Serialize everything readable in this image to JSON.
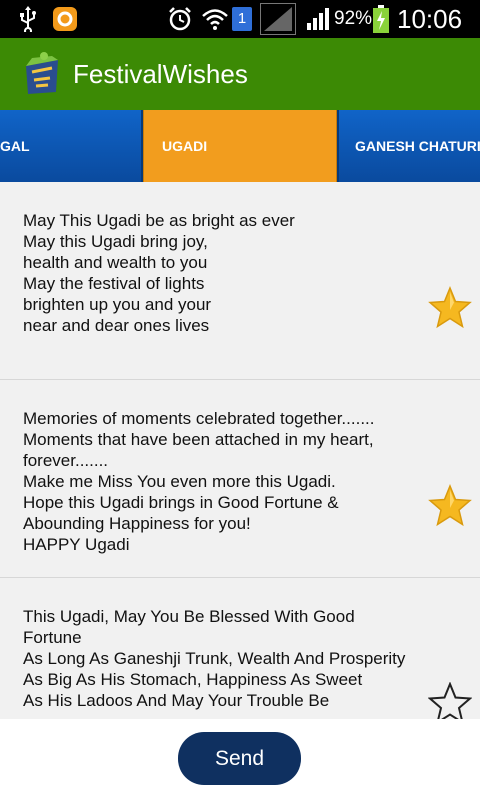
{
  "status_bar": {
    "icons": [
      "usb-icon",
      "notification-app-icon",
      "alarm-icon",
      "wifi-icon",
      "sim-slot-icon",
      "signal-empty-icon",
      "signal-icon",
      "battery-charging-icon"
    ],
    "sim_slot": "1",
    "battery_percent": "92%",
    "time": "10:06"
  },
  "app_bar": {
    "title": "FestivalWishes",
    "logo_icon": "festival-lantern-icon"
  },
  "tabs": [
    {
      "label": "GAL",
      "active": false
    },
    {
      "label": "UGADI",
      "active": true
    },
    {
      "label": "GANESH CHATURI",
      "active": false
    }
  ],
  "wishes": [
    {
      "text": "May This Ugadi be as bright as ever\nMay this Ugadi bring joy,\nhealth and wealth to you\nMay the festival of lights\nbrighten up you and your\nnear and dear ones lives",
      "favorite": true
    },
    {
      "text": "Memories of moments celebrated together.......\nMoments that have been attached in my heart, forever.......\nMake me Miss You even more this Ugadi.\nHope this Ugadi brings in Good Fortune &\nAbounding Happiness for you!\nHAPPY Ugadi",
      "favorite": true
    },
    {
      "text": "This Ugadi, May You Be Blessed With Good Fortune\nAs Long As Ganeshji Trunk, Wealth And Prosperity\nAs Big As His Stomach, Happiness As Sweet\nAs His Ladoos And May Your Trouble Be",
      "favorite": false
    }
  ],
  "colors": {
    "action_bar": "#3c8a05",
    "tab_bar": "#0a4a9e",
    "tab_active": "#f29d1e",
    "send_button": "#0f3060",
    "star": "#f5b820"
  },
  "footer": {
    "send_label": "Send"
  }
}
